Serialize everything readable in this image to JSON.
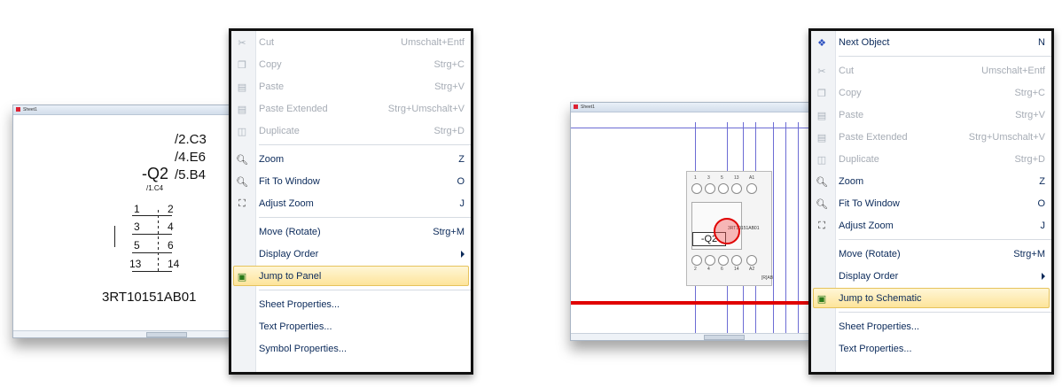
{
  "left_window": {
    "title": "Sheet1",
    "symbol": {
      "designation": "-Q2",
      "location_ref": "/1.C4",
      "cross_refs": [
        "/2.C3",
        "/4.E6",
        "/5.B4"
      ],
      "contacts": [
        {
          "a": "1",
          "b": "2"
        },
        {
          "a": "3",
          "b": "4"
        },
        {
          "a": "5",
          "b": "6"
        },
        {
          "a": "13",
          "b": "14"
        }
      ],
      "part_number": "3RT10151AB01"
    }
  },
  "left_menu": {
    "items": [
      {
        "label": "Cut",
        "shortcut": "Umschalt+Entf",
        "icon": "scissors-icon",
        "enabled": false
      },
      {
        "label": "Copy",
        "shortcut": "Strg+C",
        "icon": "copy-icon",
        "enabled": false
      },
      {
        "label": "Paste",
        "shortcut": "Strg+V",
        "icon": "paste-icon",
        "enabled": false
      },
      {
        "label": "Paste Extended",
        "shortcut": "Strg+Umschalt+V",
        "icon": "paste-extended-icon",
        "enabled": false
      },
      {
        "label": "Duplicate",
        "shortcut": "Strg+D",
        "icon": "duplicate-icon",
        "enabled": false
      },
      {
        "label": "Zoom",
        "shortcut": "Z",
        "icon": "zoom-icon",
        "enabled": true
      },
      {
        "label": "Fit To Window",
        "shortcut": "O",
        "icon": "fit-to-window-icon",
        "enabled": true
      },
      {
        "label": "Adjust Zoom",
        "shortcut": "J",
        "icon": "adjust-zoom-icon",
        "enabled": true
      },
      {
        "label": "Move (Rotate)",
        "shortcut": "Strg+M",
        "icon": "",
        "enabled": true
      },
      {
        "label": "Display Order",
        "shortcut": "",
        "icon": "",
        "enabled": true,
        "submenu": true
      },
      {
        "label": "Jump to Panel",
        "shortcut": "",
        "icon": "jump-to-panel-icon",
        "enabled": true,
        "highlighted": true
      },
      {
        "label": "Sheet Properties...",
        "shortcut": "",
        "icon": "",
        "enabled": true
      },
      {
        "label": "Text Properties...",
        "shortcut": "",
        "icon": "",
        "enabled": true
      },
      {
        "label": "Symbol Properties...",
        "shortcut": "",
        "icon": "",
        "enabled": true
      }
    ]
  },
  "right_window": {
    "title": "Sheet1",
    "device": {
      "designation": "-Q2",
      "top_terminals": [
        "1",
        "3",
        "5",
        "13",
        "A1"
      ],
      "bottom_terminals": [
        "2",
        "4",
        "6",
        "14",
        "A2"
      ],
      "side_label": "3RT10151AB01",
      "bottom_label": "[R]AB"
    }
  },
  "right_menu": {
    "items": [
      {
        "label": "Next Object",
        "shortcut": "N",
        "icon": "next-object-icon",
        "enabled": true
      },
      {
        "label": "Cut",
        "shortcut": "Umschalt+Entf",
        "icon": "scissors-icon",
        "enabled": false
      },
      {
        "label": "Copy",
        "shortcut": "Strg+C",
        "icon": "copy-icon",
        "enabled": false
      },
      {
        "label": "Paste",
        "shortcut": "Strg+V",
        "icon": "paste-icon",
        "enabled": false
      },
      {
        "label": "Paste Extended",
        "shortcut": "Strg+Umschalt+V",
        "icon": "paste-extended-icon",
        "enabled": false
      },
      {
        "label": "Duplicate",
        "shortcut": "Strg+D",
        "icon": "duplicate-icon",
        "enabled": false
      },
      {
        "label": "Zoom",
        "shortcut": "Z",
        "icon": "zoom-icon",
        "enabled": true
      },
      {
        "label": "Fit To Window",
        "shortcut": "O",
        "icon": "fit-to-window-icon",
        "enabled": true
      },
      {
        "label": "Adjust Zoom",
        "shortcut": "J",
        "icon": "adjust-zoom-icon",
        "enabled": true
      },
      {
        "label": "Move (Rotate)",
        "shortcut": "Strg+M",
        "icon": "",
        "enabled": true
      },
      {
        "label": "Display Order",
        "shortcut": "",
        "icon": "",
        "enabled": true,
        "submenu": true
      },
      {
        "label": "Jump to Schematic",
        "shortcut": "",
        "icon": "jump-to-schematic-icon",
        "enabled": true,
        "highlighted": true
      },
      {
        "label": "Sheet Properties...",
        "shortcut": "",
        "icon": "",
        "enabled": true
      },
      {
        "label": "Text Properties...",
        "shortcut": "",
        "icon": "",
        "enabled": true
      }
    ]
  },
  "colors": {
    "menu_text": "#0b2a5a",
    "disabled_text": "#a6acb5",
    "highlight": "#fde49a",
    "wire_red": "#e00000",
    "grid_blue": "#6c6cd4"
  }
}
